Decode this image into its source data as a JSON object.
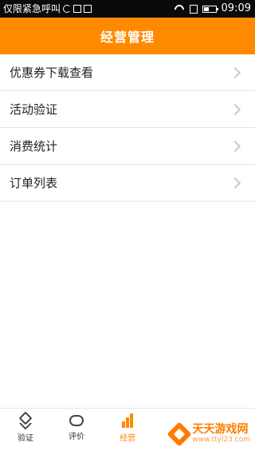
{
  "status_bar": {
    "notice": "仅限紧急呼叫",
    "time": "09:09"
  },
  "header": {
    "title": "经营管理"
  },
  "menu": {
    "items": [
      {
        "label": "优惠券下载查看"
      },
      {
        "label": "活动验证"
      },
      {
        "label": "消费统计"
      },
      {
        "label": "订单列表"
      }
    ]
  },
  "tabs": [
    {
      "label": "验证",
      "icon": "verify-icon"
    },
    {
      "label": "评价",
      "icon": "chat-icon"
    },
    {
      "label": "经营",
      "icon": "bar-chart-icon"
    }
  ],
  "watermark": {
    "title": "天天游戏网",
    "url": "www.ttyl23.com"
  },
  "colors": {
    "accent": "#ff8a00",
    "status_bar": "#0a0a0a"
  }
}
